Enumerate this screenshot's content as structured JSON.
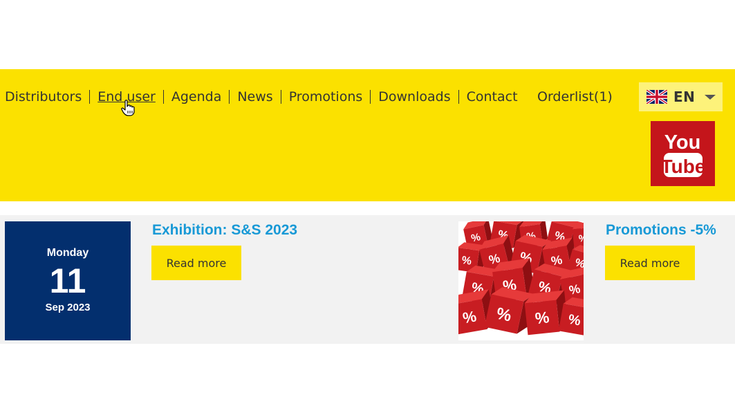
{
  "nav": {
    "items": [
      "Distributors",
      "End user",
      "Agenda",
      "News",
      "Promotions",
      "Downloads",
      "Contact"
    ],
    "orderlist": "Orderlist(1)"
  },
  "language": {
    "code": "EN",
    "flag": "uk-flag-icon"
  },
  "youtube": {
    "line1": "You",
    "line2": "Tube"
  },
  "colors": {
    "header": "#fbe100",
    "date_box": "#032f6e",
    "title": "#1899d6",
    "button": "#fbe100",
    "youtube": "#c4151b"
  },
  "items": [
    {
      "date": {
        "weekday": "Monday",
        "day": "11",
        "month": "Sep 2023"
      },
      "title": "Exhibition: S&S 2023",
      "button": "Read more"
    },
    {
      "image": "percent-cubes-image",
      "title": "Promotions -5%",
      "button": "Read more"
    }
  ]
}
